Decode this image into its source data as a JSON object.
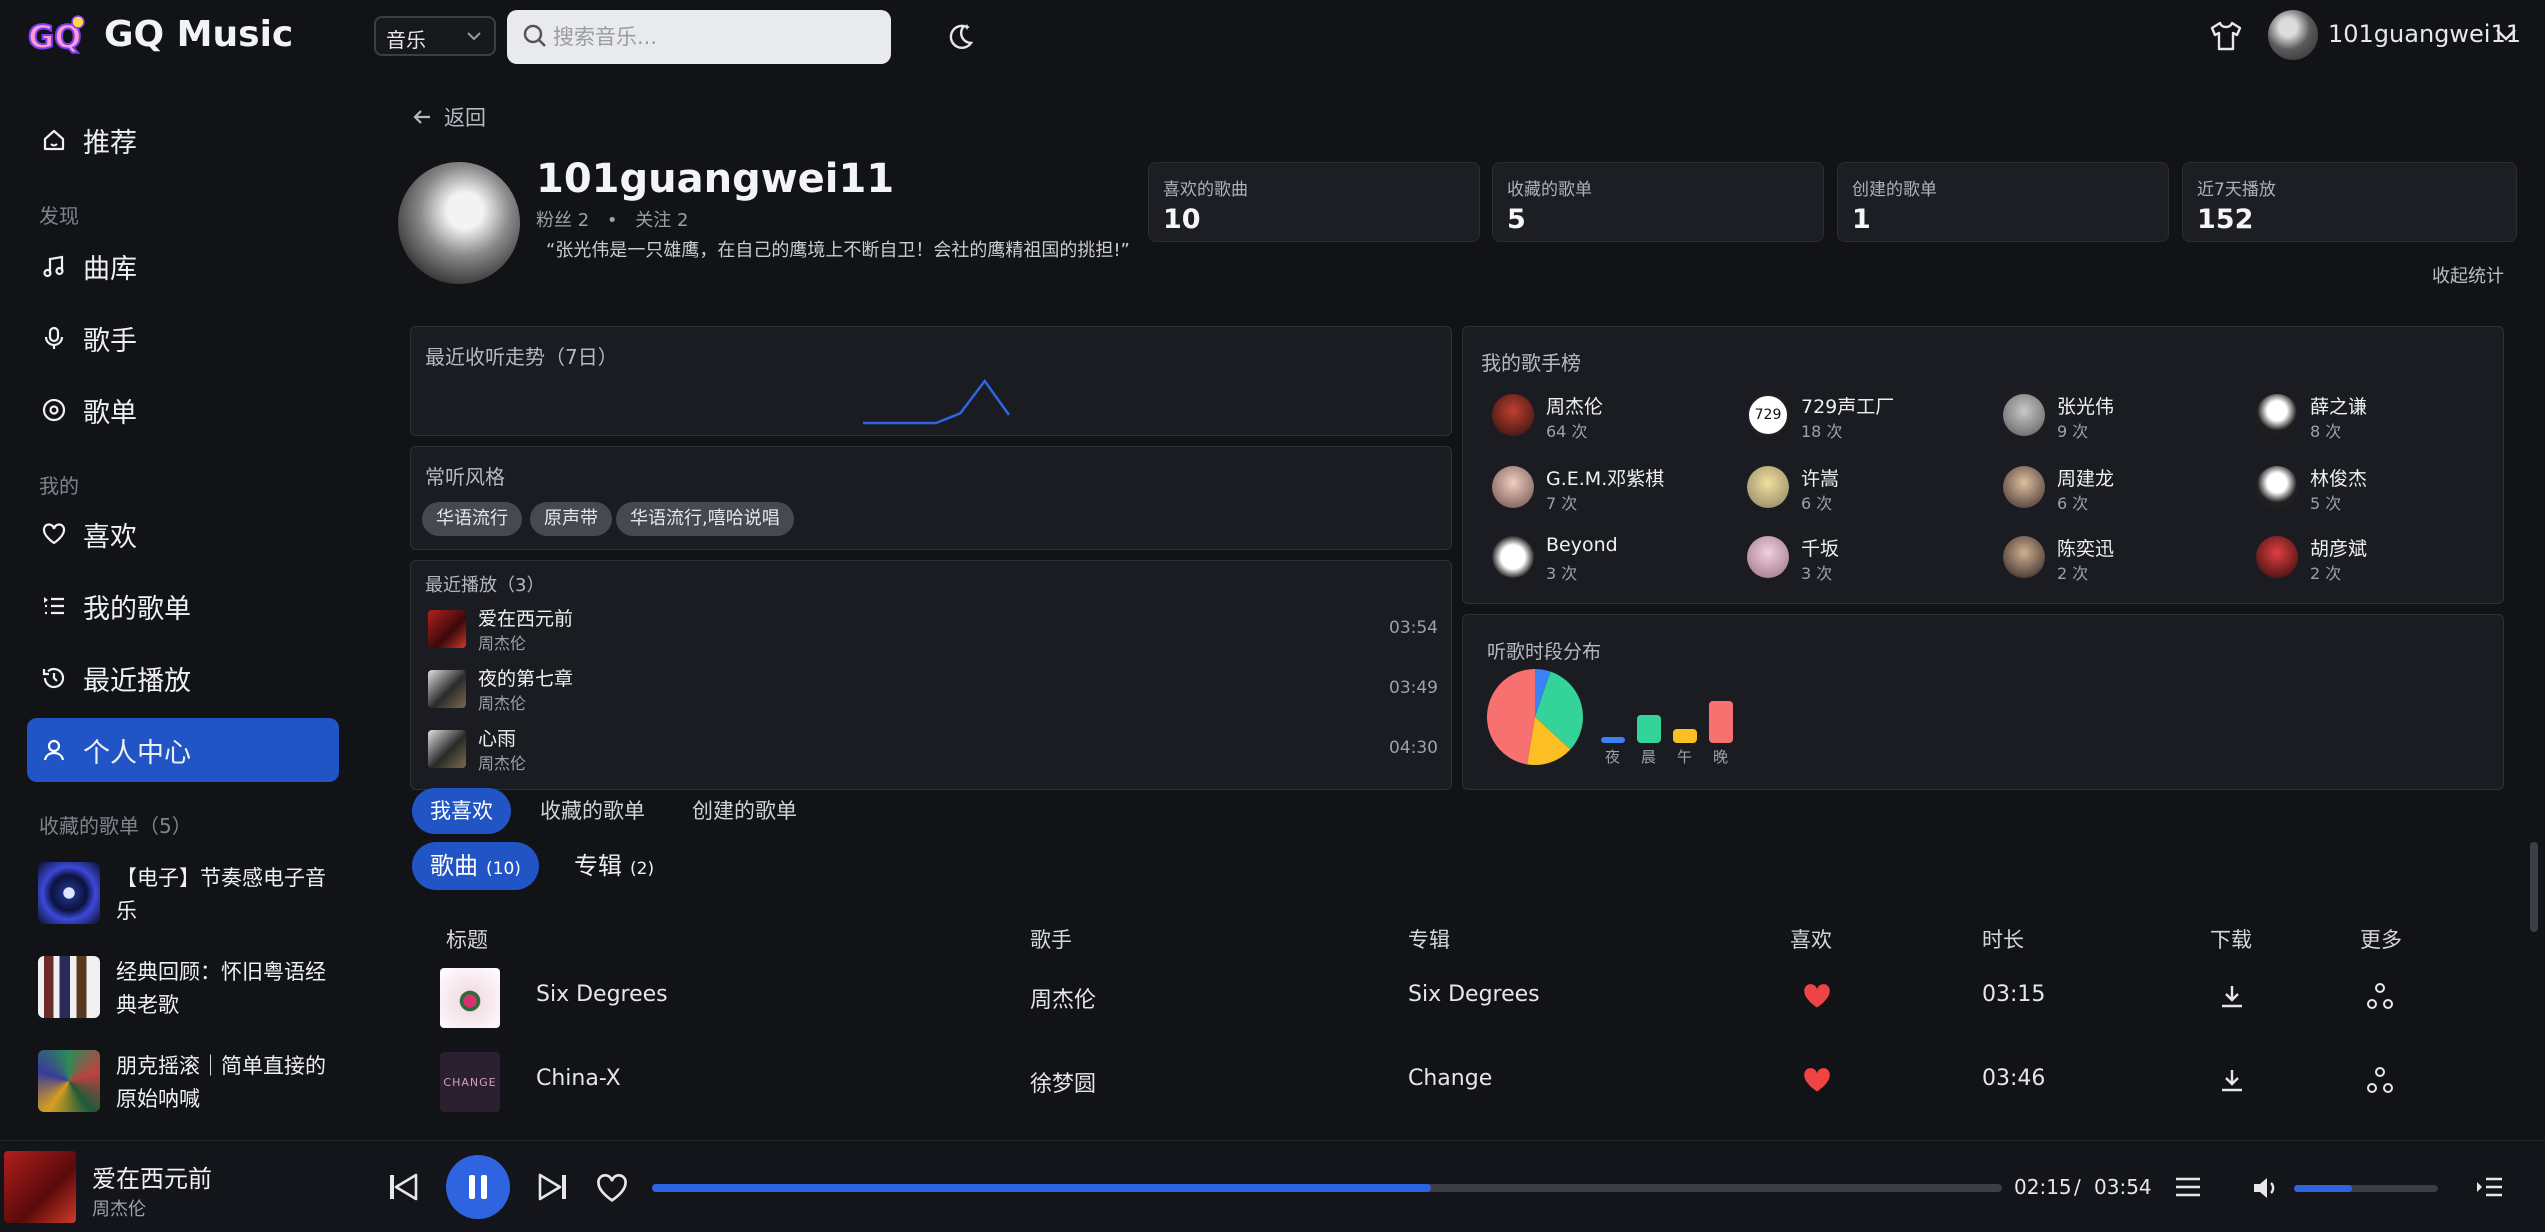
{
  "app": {
    "title": "GQ Music",
    "logo_text": "GQ"
  },
  "header": {
    "category_select": "音乐",
    "search_placeholder": "搜索音乐...",
    "username": "101guangwei11"
  },
  "sidebar": {
    "nav_top": [
      {
        "label": "推荐",
        "icon": "home-icon"
      }
    ],
    "discover_label": "发现",
    "discover": [
      {
        "label": "曲库",
        "icon": "music-note-icon"
      },
      {
        "label": "歌手",
        "icon": "microphone-icon"
      },
      {
        "label": "歌单",
        "icon": "disc-icon"
      }
    ],
    "mine_label": "我的",
    "mine": [
      {
        "label": "喜欢",
        "icon": "heart-icon"
      },
      {
        "label": "我的歌单",
        "icon": "playlist-icon"
      },
      {
        "label": "最近播放",
        "icon": "history-icon"
      },
      {
        "label": "个人中心",
        "icon": "user-icon",
        "active": true
      }
    ],
    "favorites_label": "收藏的歌单（5）",
    "favorites": [
      {
        "title": "【电子】节奏感电子音乐"
      },
      {
        "title": "经典回顾：怀旧粤语经典老歌"
      },
      {
        "title": "朋克摇滚｜简单直接的原始呐喊"
      }
    ]
  },
  "profile": {
    "back_label": "返回",
    "name": "101guangwei11",
    "fans": "粉丝 2",
    "following": "关注 2",
    "dot": "•",
    "quote": "“张光伟是一只雄鹰，在自己的鹰境上不断自卫！会社的鹰精祖国的挑担!”"
  },
  "stats": [
    {
      "label": "喜欢的歌曲",
      "value": "10"
    },
    {
      "label": "收藏的歌单",
      "value": "5"
    },
    {
      "label": "创建的歌单",
      "value": "1"
    },
    {
      "label": "近7天播放",
      "value": "152"
    }
  ],
  "collapse_stats_label": "收起统计",
  "trend": {
    "title": "最近收听走势（7日）",
    "values": [
      0,
      0,
      0,
      0,
      12,
      52,
      10
    ]
  },
  "styles": {
    "title": "常听风格",
    "tags": [
      "华语流行",
      "原声带",
      "华语流行,嘻哈说唱"
    ]
  },
  "recent": {
    "title": "最近播放（3）",
    "items": [
      {
        "title": "爱在西元前",
        "artist": "周杰伦",
        "duration": "03:54"
      },
      {
        "title": "夜的第七章",
        "artist": "周杰伦",
        "duration": "03:49"
      },
      {
        "title": "心雨",
        "artist": "周杰伦",
        "duration": "04:30"
      }
    ]
  },
  "artist_chart": {
    "title": "我的歌手榜",
    "items": [
      {
        "name": "周杰伦",
        "count": "64 次"
      },
      {
        "name": "729声工厂",
        "count": "18 次",
        "badge": "729"
      },
      {
        "name": "张光伟",
        "count": "9 次"
      },
      {
        "name": "薛之谦",
        "count": "8 次"
      },
      {
        "name": "G.E.M.邓紫棋",
        "count": "7 次"
      },
      {
        "name": "许嵩",
        "count": "6 次"
      },
      {
        "name": "周建龙",
        "count": "6 次"
      },
      {
        "name": "林俊杰",
        "count": "5 次"
      },
      {
        "name": "Beyond",
        "count": "3 次"
      },
      {
        "name": "千坂",
        "count": "3 次"
      },
      {
        "name": "陈奕迅",
        "count": "2 次"
      },
      {
        "name": "胡彦斌",
        "count": "2 次"
      }
    ]
  },
  "time_dist": {
    "title": "听歌时段分布",
    "slots": [
      {
        "label": "夜",
        "value": 1,
        "color": "#3b82f6"
      },
      {
        "label": "晨",
        "value": 6,
        "color": "#34d399"
      },
      {
        "label": "午",
        "value": 3,
        "color": "#fbbf24"
      },
      {
        "label": "晚",
        "value": 9,
        "color": "#f87171"
      }
    ]
  },
  "tabs_top": [
    {
      "label": "我喜欢",
      "active": true
    },
    {
      "label": "收藏的歌单"
    },
    {
      "label": "创建的歌单"
    }
  ],
  "tabs_sub": [
    {
      "label": "歌曲",
      "count": "(10)",
      "active": true
    },
    {
      "label": "专辑",
      "count": "(2)"
    }
  ],
  "table": {
    "headers": [
      "标题",
      "歌手",
      "专辑",
      "喜欢",
      "时长",
      "下载",
      "更多"
    ],
    "rows": [
      {
        "title": "Six Degrees",
        "artist": "周杰伦",
        "album": "Six Degrees",
        "duration": "03:15",
        "liked": true
      },
      {
        "title": "China-X",
        "artist": "徐梦圆",
        "album": "Change",
        "duration": "03:46",
        "liked": true,
        "cover_text": "CHANGE"
      }
    ]
  },
  "player": {
    "title": "爱在西元前",
    "artist": "周杰伦",
    "current": "02:15",
    "separator": "/",
    "total": "03:54",
    "progress": 0.577,
    "volume": 0.4
  },
  "colors": {
    "accent": "#2154c4",
    "heart": "#ef4444",
    "bg": "#121317"
  }
}
